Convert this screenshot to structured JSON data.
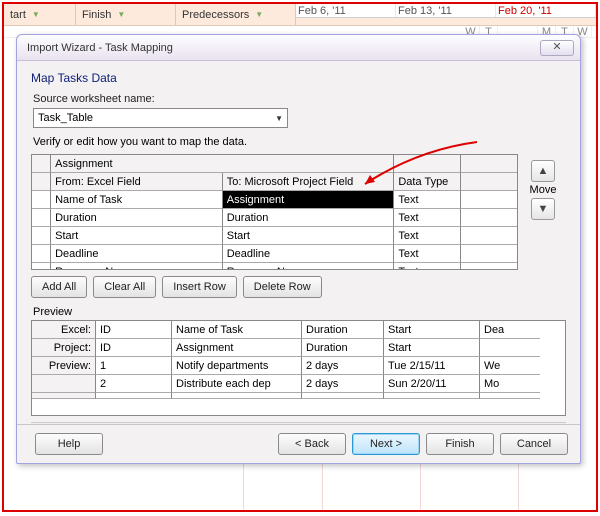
{
  "sheet_columns": {
    "c1": "tart",
    "c2": "Finish",
    "c3": "Predecessors"
  },
  "timeline": [
    "Feb 6, '11",
    "Feb 13, '11",
    "Feb 20, '11"
  ],
  "day_letters": [
    "W",
    "T",
    "M",
    "T",
    "W"
  ],
  "dialog": {
    "title": "Import Wizard - Task Mapping",
    "close_symbol": "✕",
    "heading": "Map Tasks Data",
    "source_label": "Source worksheet name:",
    "source_value": "Task_Table",
    "verify_text": "Verify or edit how you want to map the data.",
    "top_assignment": "Assignment",
    "grid_headers": {
      "from": "From: Excel Field",
      "to": "To:  Microsoft Project Field",
      "type": "Data Type"
    },
    "map_rows": [
      {
        "from": "Name of Task",
        "to": "Assignment",
        "type": "Text",
        "selected": true
      },
      {
        "from": "Duration",
        "to": "Duration",
        "type": "Text"
      },
      {
        "from": "Start",
        "to": "Start",
        "type": "Text"
      },
      {
        "from": "Deadline",
        "to": "Deadline",
        "type": "Text"
      },
      {
        "from": "Resource Names",
        "to": "Resource Names",
        "type": "Text"
      }
    ],
    "move_label": "Move",
    "buttons": {
      "add_all": "Add All",
      "clear_all": "Clear All",
      "insert_row": "Insert Row",
      "delete_row": "Delete Row"
    },
    "preview_label": "Preview",
    "preview_headers": {
      "excel": "Excel:",
      "project": "Project:",
      "preview": "Preview:"
    },
    "preview_cols": [
      "ID",
      "Name of Task",
      "Duration",
      "Start",
      "Dea"
    ],
    "preview_proj_cols": [
      "ID",
      "Assignment",
      "Duration",
      "Start",
      ""
    ],
    "preview_rows": [
      {
        "n": "1",
        "name": "Notify departments",
        "dur": "2 days",
        "start": "Tue 2/15/11",
        "end": "We"
      },
      {
        "n": "2",
        "name": "Distribute each dep",
        "dur": "2 days",
        "start": "Sun 2/20/11",
        "end": "Mo"
      }
    ],
    "footer": {
      "help": "Help",
      "back": "< Back",
      "next": "Next >",
      "finish": "Finish",
      "cancel": "Cancel"
    }
  }
}
